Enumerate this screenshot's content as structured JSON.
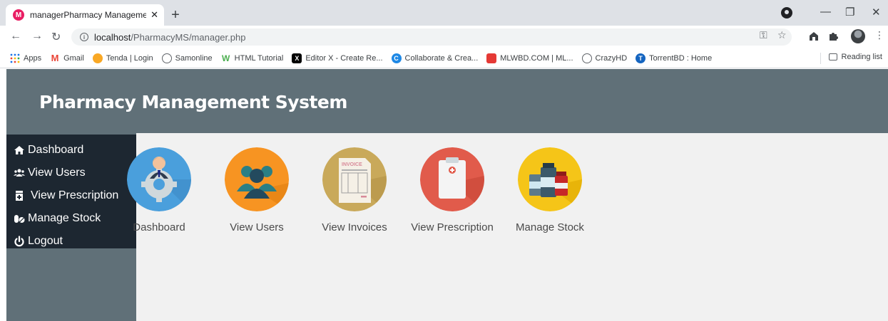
{
  "browser": {
    "tab_title": "managerPharmacy Management",
    "tab_favicon_letter": "M",
    "url_host": "localhost",
    "url_path": "/PharmacyMS/manager.php",
    "bookmarks": [
      {
        "label": "Apps",
        "icon": "apps-grid-icon",
        "color": "#1a73e8"
      },
      {
        "label": "Gmail",
        "icon": "gmail-icon",
        "color": "#ea4335"
      },
      {
        "label": "Tenda | Login",
        "icon": "tenda-icon",
        "color": "#f9a825"
      },
      {
        "label": "Samonline",
        "icon": "globe-icon",
        "color": "#5f6368"
      },
      {
        "label": "HTML Tutorial",
        "icon": "w3schools-icon",
        "color": "#4caf50"
      },
      {
        "label": "Editor X - Create Re...",
        "icon": "editorx-icon",
        "color": "#000000"
      },
      {
        "label": "Collaborate & Crea...",
        "icon": "canva-icon",
        "color": "#1e88e5"
      },
      {
        "label": "MLWBD.COM | ML...",
        "icon": "mlwbd-icon",
        "color": "#e53935"
      },
      {
        "label": "CrazyHD",
        "icon": "globe-icon",
        "color": "#5f6368"
      },
      {
        "label": "TorrentBD : Home",
        "icon": "torrentbd-icon",
        "color": "#1565c0"
      }
    ],
    "reading_list": "Reading list"
  },
  "app": {
    "title": "Pharmacy Management System",
    "menu": [
      {
        "label": "Dashboard",
        "icon": "home-icon"
      },
      {
        "label": "View Users",
        "icon": "users-icon"
      },
      {
        "label": "View Prescription",
        "icon": "prescription-icon"
      },
      {
        "label": "Manage Stock",
        "icon": "pills-icon"
      },
      {
        "label": "Logout",
        "icon": "power-icon"
      }
    ],
    "cards": [
      {
        "label": "Dashboard",
        "icon": "manager-gear-icon",
        "color": "#4a9fdc"
      },
      {
        "label": "View Users",
        "icon": "users-group-icon",
        "color": "#f79422"
      },
      {
        "label": "View Invoices",
        "icon": "invoice-icon",
        "color": "#c9a95a"
      },
      {
        "label": "View Prescription",
        "icon": "clipboard-icon",
        "color": "#e15b4b"
      },
      {
        "label": "Manage Stock",
        "icon": "medicine-bottles-icon",
        "color": "#f5c518"
      }
    ],
    "invoice_word": "INVOICE"
  }
}
